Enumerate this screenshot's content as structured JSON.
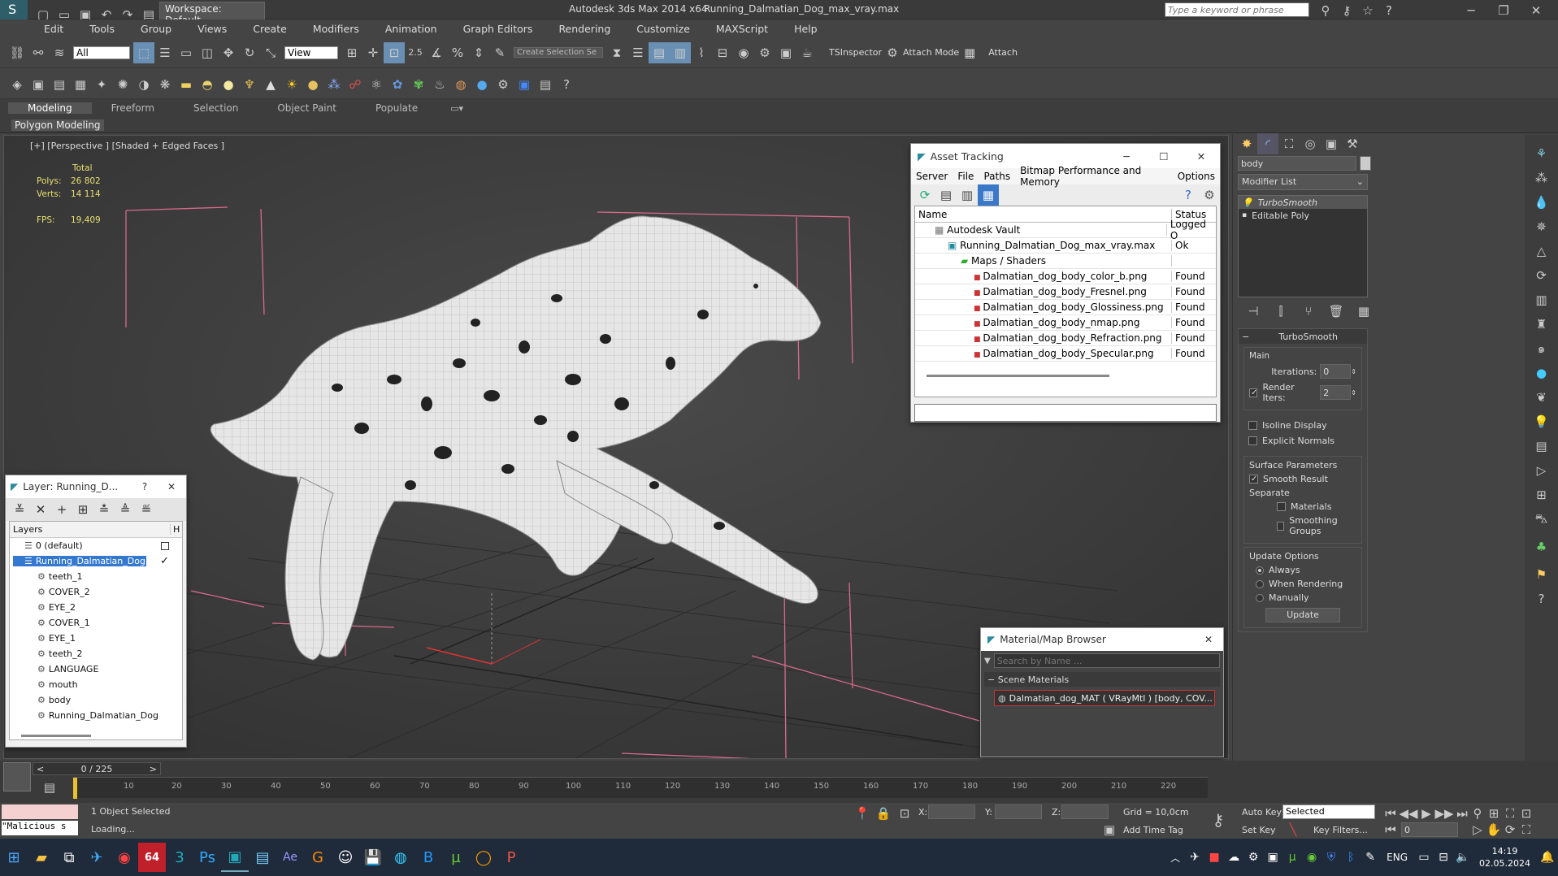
{
  "window": {
    "app_title": "Autodesk 3ds Max  2014 x64",
    "file_title": "Running_Dalmatian_Dog_max_vray.max",
    "workspace": "Workspace: Default",
    "search_placeholder": "Type a keyword or phrase"
  },
  "menu": [
    "Edit",
    "Tools",
    "Group",
    "Views",
    "Create",
    "Modifiers",
    "Animation",
    "Graph Editors",
    "Rendering",
    "Customize",
    "MAXScript",
    "Help"
  ],
  "toolbar": {
    "selection_filter": "All",
    "ref_coord": "View",
    "snap_value": "2.5",
    "named_selection": "Create Selection Se",
    "tsinspector": "TSInspector",
    "attach_mode": "Attach Mode",
    "attach": "Attach"
  },
  "ribbon": {
    "tabs": [
      "Modeling",
      "Freeform",
      "Selection",
      "Object Paint",
      "Populate"
    ],
    "sub": "Polygon Modeling"
  },
  "viewport": {
    "label": "[+] [Perspective ] [Shaded + Edged Faces ]",
    "stats_total": "Total",
    "polys_label": "Polys:",
    "polys_value": "26 802",
    "verts_label": "Verts:",
    "verts_value": "14 114",
    "fps_label": "FPS:",
    "fps_value": "19,409"
  },
  "asset_tracking": {
    "title": "Asset Tracking",
    "menu": [
      "Server",
      "File",
      "Paths",
      "Bitmap Performance and Memory",
      "Options"
    ],
    "col_name": "Name",
    "col_status": "Status",
    "rows": [
      {
        "name": "Autodesk Vault",
        "status": "Logged O",
        "indent": 0
      },
      {
        "name": "Running_Dalmatian_Dog_max_vray.max",
        "status": "Ok",
        "indent": 1
      },
      {
        "name": "Maps / Shaders",
        "status": "",
        "indent": 2
      },
      {
        "name": "Dalmatian_dog_body_color_b.png",
        "status": "Found",
        "indent": 3
      },
      {
        "name": "Dalmatian_dog_body_Fresnel.png",
        "status": "Found",
        "indent": 3
      },
      {
        "name": "Dalmatian_dog_body_Glossiness.png",
        "status": "Found",
        "indent": 3
      },
      {
        "name": "Dalmatian_dog_body_nmap.png",
        "status": "Found",
        "indent": 3
      },
      {
        "name": "Dalmatian_dog_body_Refraction.png",
        "status": "Found",
        "indent": 3
      },
      {
        "name": "Dalmatian_dog_body_Specular.png",
        "status": "Found",
        "indent": 3
      }
    ]
  },
  "layer_panel": {
    "title": "Layer: Running_D...",
    "help": "?",
    "col_layers": "Layers",
    "col_h": "H",
    "items": [
      {
        "name": "0 (default)",
        "level": 0,
        "selected": false
      },
      {
        "name": "Running_Dalmatian_Dog",
        "level": 0,
        "selected": true
      },
      {
        "name": "teeth_1",
        "level": 1,
        "selected": false
      },
      {
        "name": "COVER_2",
        "level": 1,
        "selected": false
      },
      {
        "name": "EYE_2",
        "level": 1,
        "selected": false
      },
      {
        "name": "COVER_1",
        "level": 1,
        "selected": false
      },
      {
        "name": "EYE_1",
        "level": 1,
        "selected": false
      },
      {
        "name": "teeth_2",
        "level": 1,
        "selected": false
      },
      {
        "name": "LANGUAGE",
        "level": 1,
        "selected": false
      },
      {
        "name": "mouth",
        "level": 1,
        "selected": false
      },
      {
        "name": "body",
        "level": 1,
        "selected": false
      },
      {
        "name": "Running_Dalmatian_Dog",
        "level": 1,
        "selected": false
      }
    ]
  },
  "material_browser": {
    "title": "Material/Map Browser",
    "search_placeholder": "Search by Name ...",
    "section": "Scene Materials",
    "item": "Dalmatian_dog_MAT ( VRayMtl ) [body, COV..."
  },
  "command_panel": {
    "object_name": "body",
    "modifier_list": "Modifier List",
    "stack": [
      "TurboSmooth",
      "Editable Poly"
    ],
    "rollout_title": "TurboSmooth",
    "main_label": "Main",
    "iterations_label": "Iterations:",
    "iterations_value": "0",
    "render_iters_label": "Render Iters:",
    "render_iters_value": "2",
    "isoline": "Isoline Display",
    "explicit_normals": "Explicit Normals",
    "surface_params": "Surface Parameters",
    "smooth_result": "Smooth Result",
    "separate": "Separate",
    "materials": "Materials",
    "smoothing_groups": "Smoothing Groups",
    "update_options": "Update Options",
    "always": "Always",
    "when_rendering": "When Rendering",
    "manually": "Manually",
    "update_btn": "Update"
  },
  "timeline": {
    "frame_counter": "0 / 225",
    "ticks": [
      "10",
      "20",
      "30",
      "40",
      "50",
      "60",
      "70",
      "80",
      "90",
      "100",
      "110",
      "120",
      "130",
      "140",
      "150",
      "160",
      "170",
      "180",
      "190",
      "200",
      "210",
      "220"
    ]
  },
  "status": {
    "maxscript": "\"Malicious s",
    "selected": "1 Object Selected",
    "loading": "Loading...",
    "x_label": "X:",
    "y_label": "Y:",
    "z_label": "Z:",
    "grid": "Grid = 10,0cm",
    "add_time_tag": "Add Time Tag",
    "auto_key": "Auto Key",
    "set_key": "Set Key",
    "selected_dropdown": "Selected",
    "key_filters": "Key Filters...",
    "frame": "0"
  },
  "taskbar": {
    "lang": "ENG",
    "time": "14:19",
    "date": "02.05.2024",
    "badge": "64"
  }
}
